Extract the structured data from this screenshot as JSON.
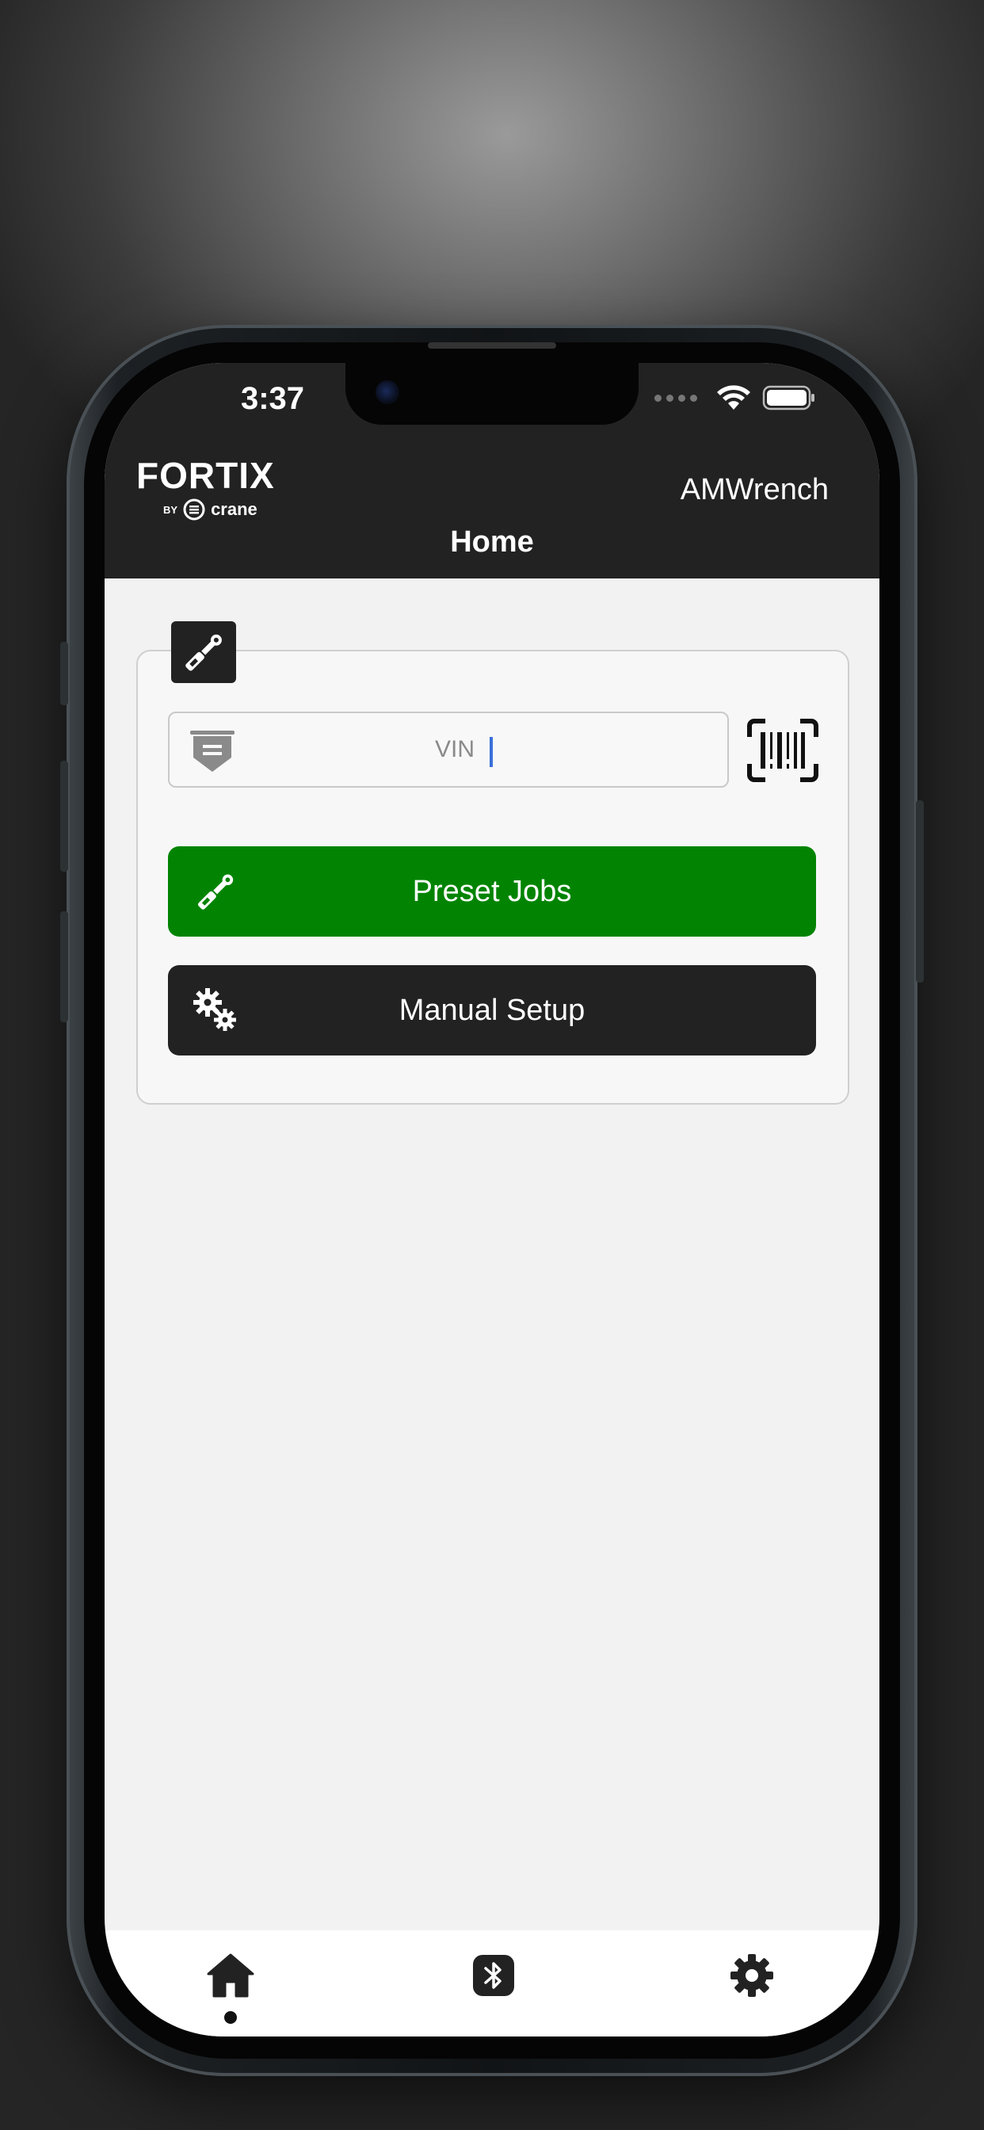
{
  "status_bar": {
    "time": "3:37"
  },
  "header": {
    "logo": {
      "brand": "FORTIX",
      "by": "BY",
      "maker": "crane"
    },
    "device_name": "AMWrench",
    "title": "Home"
  },
  "vin": {
    "placeholder": "VIN",
    "value": ""
  },
  "buttons": {
    "preset_jobs": "Preset Jobs",
    "manual_setup": "Manual Setup"
  },
  "tabs": [
    {
      "name": "home",
      "icon": "home-icon",
      "active": true
    },
    {
      "name": "bluetooth",
      "icon": "bluetooth-icon",
      "active": false
    },
    {
      "name": "settings",
      "icon": "gear-icon",
      "active": false
    }
  ],
  "colors": {
    "header_bg": "#222222",
    "preset_btn": "#028402",
    "manual_btn": "#222222",
    "screen_bg": "#f2f2f2",
    "caret": "#3a6fd8"
  }
}
